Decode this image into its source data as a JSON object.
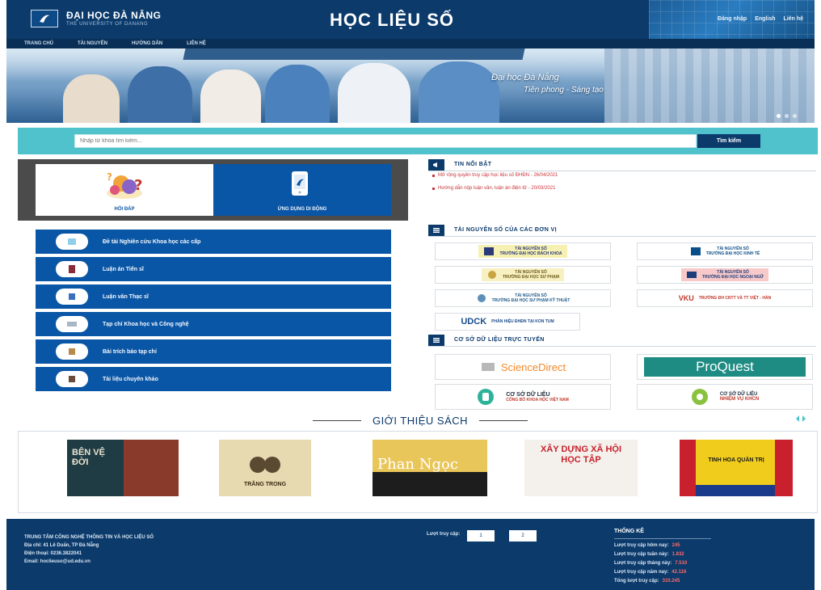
{
  "header": {
    "logo_title": "ĐẠI HỌC ĐÀ NẴNG",
    "logo_subtitle": "THE UNIVERSITY OF DANANG",
    "site_title": "HỌC LIỆU SỐ",
    "links": [
      "Đăng nhập",
      "English",
      "Liên hệ"
    ]
  },
  "nav": {
    "items": [
      "Trang chủ",
      "Tài nguyên",
      "Hướng dẫn",
      "Liên hệ"
    ]
  },
  "banner": {
    "slogan_line1": "Đại học Đà Nẵng",
    "slogan_line2": "Tiên phong - Sáng tạo"
  },
  "search": {
    "placeholder": "Nhập từ khóa tìm kiếm...",
    "button_label": "Tìm kiếm"
  },
  "features": [
    {
      "label": "HỎI ĐÁP"
    },
    {
      "label": "ỨNG DỤNG DI ĐỘNG"
    }
  ],
  "categories": [
    {
      "label": "Đề tài Nghiên cứu Khoa học các cấp",
      "icon": "research-icon"
    },
    {
      "label": "Luận án Tiến sĩ",
      "icon": "book-icon"
    },
    {
      "label": "Luận văn Thạc sĩ",
      "icon": "thesis-icon"
    },
    {
      "label": "Tạp chí Khoa học và Công nghệ",
      "icon": "journal-icon"
    },
    {
      "label": "Bài trích báo tạp chí",
      "icon": "article-icon"
    },
    {
      "label": "Tài liệu chuyên khảo",
      "icon": "monograph-icon"
    }
  ],
  "news": {
    "title": "TIN NỔI BẬT",
    "items": [
      "Mở rộng quyền truy cập học liệu số ĐHĐN - 26/04/2021",
      "Hướng dẫn nộp luận văn, luận án điện tử - 20/03/2021"
    ]
  },
  "units": {
    "title": "TÀI NGUYÊN SỐ CỦA CÁC ĐƠN VỊ",
    "items": [
      {
        "line1": "TÀI NGUYÊN SỐ",
        "line2": "TRƯỜNG ĐẠI HỌC BÁCH KHOA",
        "bg": "#f6f0b3",
        "color": "#2b3a7a"
      },
      {
        "line1": "TÀI NGUYÊN SỐ",
        "line2": "TRƯỜNG ĐẠI HỌC KINH TẾ",
        "bg": "#ffffff",
        "color": "#0b4f8a"
      },
      {
        "line1": "TÀI NGUYÊN SỐ",
        "line2": "TRƯỜNG ĐẠI HỌC SƯ PHẠM",
        "bg": "#f7f0c0",
        "color": "#6b5a1a"
      },
      {
        "line1": "TÀI NGUYÊN SỐ",
        "line2": "TRƯỜNG ĐẠI HỌC NGOẠI NGỮ",
        "bg": "#f8c9c9",
        "color": "#1c3c7a"
      },
      {
        "line1": "TÀI NGUYÊN SỐ",
        "line2": "TRƯỜNG ĐẠI HỌC SƯ PHẠM KỸ THUẬT",
        "bg": "#ffffff",
        "color": "#1b5a8a"
      },
      {
        "line1": "VKU",
        "line2": "TRƯỜNG ĐH CNTT VÀ TT VIỆT - HÀN",
        "bg": "#ffffff",
        "color": "#c0392b"
      },
      {
        "line1": "UDCK",
        "line2": "PHÂN HIỆU ĐHĐN TẠI KON TUM",
        "bg": "#ffffff",
        "color": "#1a4c8c"
      }
    ]
  },
  "databases": {
    "title": "CƠ SỞ DỮ LIỆU TRỰC TUYẾN",
    "items": [
      {
        "name": "ScienceDirect",
        "type": "sciencedirect"
      },
      {
        "name": "ProQuest",
        "type": "proquest"
      },
      {
        "line1": "CƠ SỞ DỮ LIỆU",
        "line2": "CÔNG BỐ KHOA HỌC VIỆT NAM",
        "type": "vn"
      },
      {
        "line1": "CƠ SỞ DỮ LIỆU",
        "line2": "NHIỆM VỤ KHCN",
        "type": "khcn"
      }
    ]
  },
  "books": {
    "title": "GIỚI THIỆU SÁCH",
    "items": [
      {
        "title": "BÊN VỆ ĐỜI",
        "bg": "#1f3b44",
        "fg": "#e9e3cf"
      },
      {
        "title": "TRĂNG TRONG",
        "bg": "#e7d9b0",
        "fg": "#3a2a12"
      },
      {
        "title": "Phan Ngọc",
        "bg": "#e9c65a",
        "fg": "#ffffff"
      },
      {
        "title": "XÂY DỰNG XÃ HỘI HỌC TẬP",
        "bg": "#f4f1ec",
        "fg": "#c8202c"
      },
      {
        "title": "TINH HOA QUẢN TRỊ",
        "bg": "#f0cd1c",
        "fg": "#1a1a1a"
      }
    ]
  },
  "footer": {
    "org": "TRUNG TÂM CÔNG NGHỆ THÔNG TIN VÀ HỌC LIỆU SỐ",
    "address": "Địa chỉ: 41 Lê Duẩn, TP Đà Nẵng",
    "phone": "Điện thoại: 0236.3822041",
    "email": "Email: hoclieuso@ud.edu.vn",
    "visits_label": "Lượt truy cập:",
    "visits": [
      "1",
      "2"
    ],
    "stats_title": "THỐNG KÊ",
    "stats": [
      {
        "label": "Lượt truy cập hôm nay:",
        "value": "245"
      },
      {
        "label": "Lượt truy cập tuần này:",
        "value": "1.832"
      },
      {
        "label": "Lượt truy cập tháng này:",
        "value": "7.510"
      },
      {
        "label": "Lượt truy cập năm nay:",
        "value": "42.116"
      },
      {
        "label": "Tổng lượt truy cập:",
        "value": "310.245"
      }
    ]
  }
}
